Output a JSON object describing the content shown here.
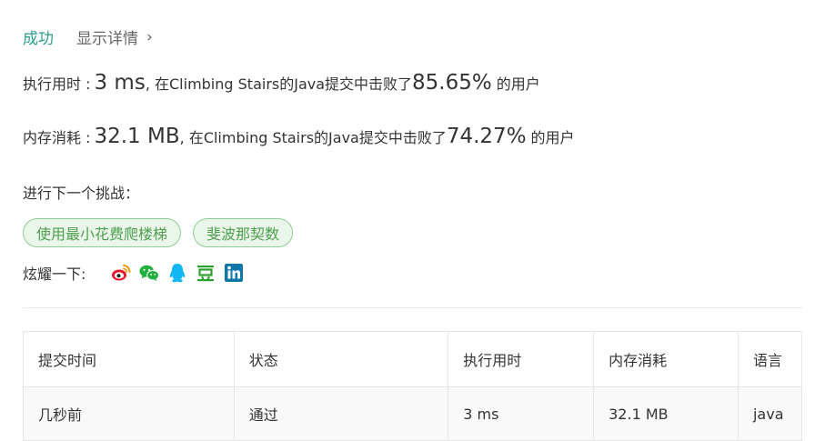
{
  "result": {
    "status": "成功",
    "details_label": "显示详情",
    "details_chevron": "›",
    "status_color": "#2b9e8c"
  },
  "runtime": {
    "label": "执行用时 :",
    "value": "3 ms",
    "mid": ", 在Climbing Stairs的Java提交中击败了",
    "percent": "85.65%",
    "suffix": "的用户"
  },
  "memory": {
    "label": "内存消耗 :",
    "value": "32.1 MB",
    "mid": ", 在Climbing Stairs的Java提交中击败了",
    "percent": "74.27%",
    "suffix": "的用户"
  },
  "next_challenge": {
    "label": "进行下一个挑战：",
    "tags": [
      "使用最小花费爬楼梯",
      "斐波那契数"
    ],
    "tag_color": "#4f9f4f"
  },
  "share": {
    "label": "炫耀一下:",
    "icons": [
      "weibo-icon",
      "wechat-icon",
      "qq-icon",
      "douban-icon",
      "linkedin-icon"
    ]
  },
  "table": {
    "headers": [
      "提交时间",
      "状态",
      "执行用时",
      "内存消耗",
      "语言"
    ],
    "rows": [
      {
        "time": "几秒前",
        "status": "通过",
        "runtime": "3 ms",
        "memory": "32.1 MB",
        "language": "java"
      }
    ]
  }
}
